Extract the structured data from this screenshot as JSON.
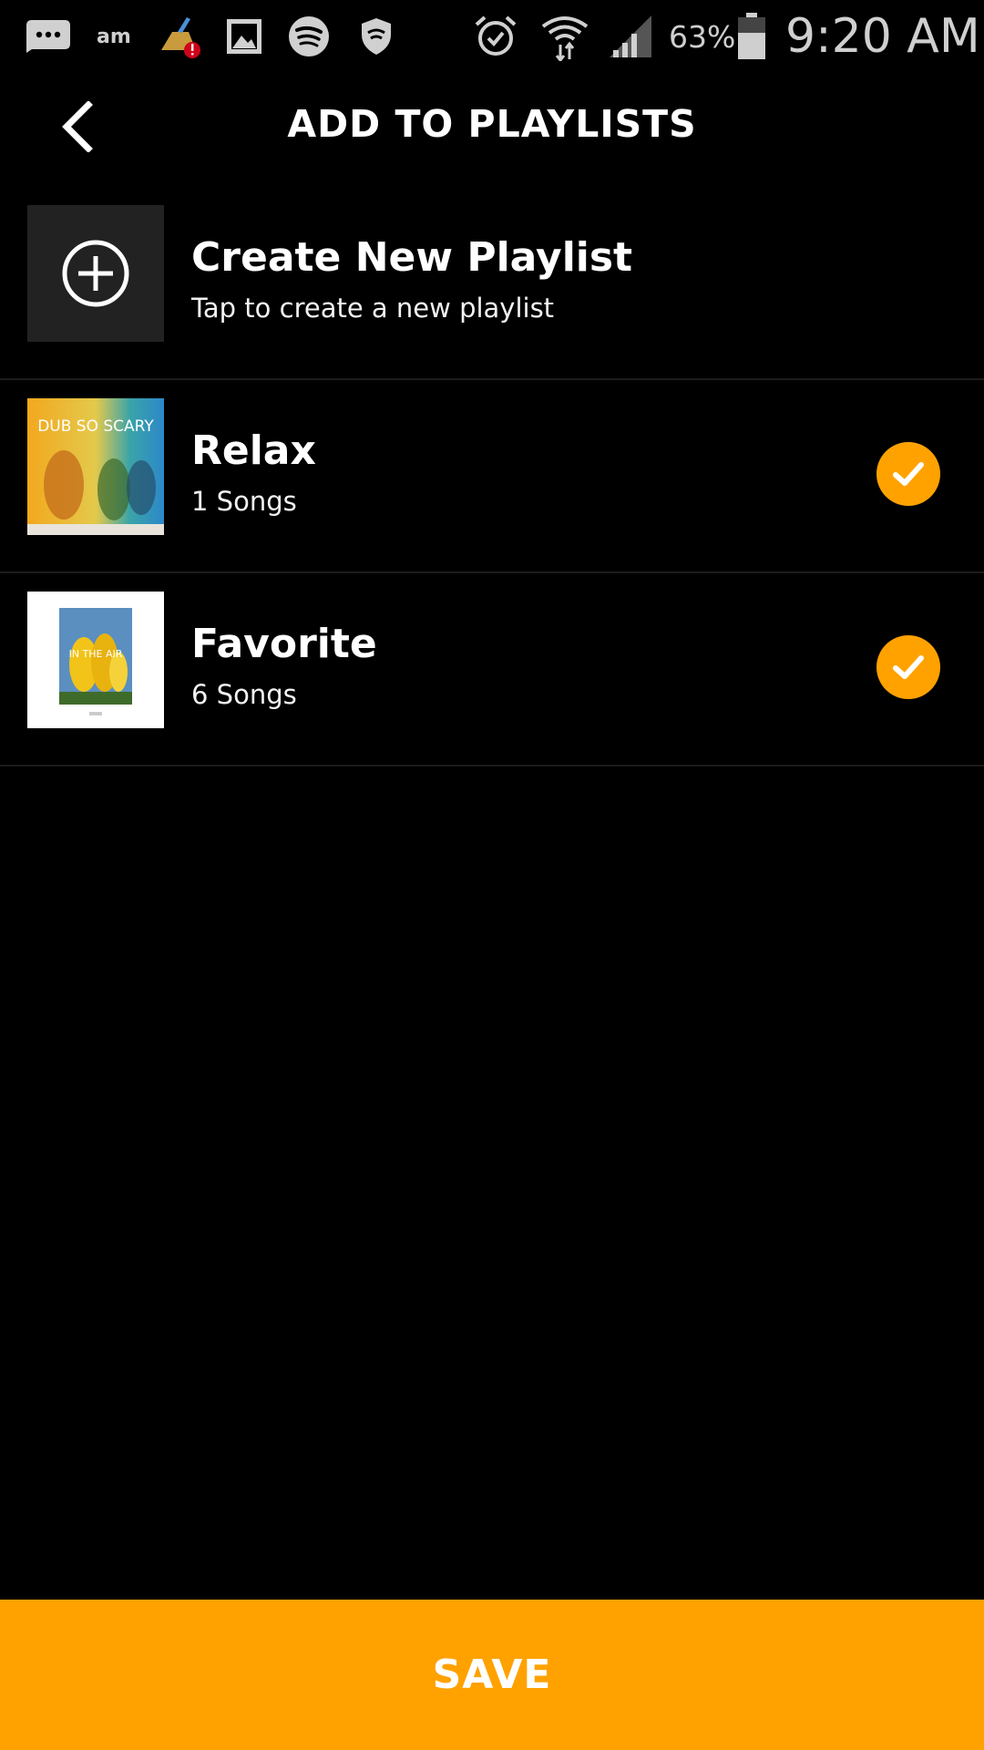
{
  "colors": {
    "background": "#000000",
    "accent": "#FFA200",
    "text": "#FFFFFF",
    "divider": "#1C1C1C",
    "create_tile": "#222222"
  },
  "status_bar": {
    "notification_icons": [
      "messages-icon",
      "am-icon",
      "cleaner-alert-icon",
      "gallery-icon",
      "spotify-icon",
      "shield-icon"
    ],
    "am_label": "am",
    "system_icons": [
      "alarm-icon",
      "wifi-icon",
      "signal-icon"
    ],
    "battery_percent": "63%",
    "battery_level": 0.63,
    "time": "9:20 AM"
  },
  "header": {
    "back_icon": "chevron-left-icon",
    "title": "ADD TO PLAYLISTS"
  },
  "create_playlist": {
    "icon": "plus-circle-icon",
    "title": "Create New Playlist",
    "subtitle": "Tap to create a new playlist"
  },
  "playlists": [
    {
      "name": "Relax",
      "count": "1 Songs",
      "selected": true,
      "artwork_text": "DUB SO SCARY"
    },
    {
      "name": "Favorite",
      "count": "6 Songs",
      "selected": true,
      "artwork_text": "IN THE AIR"
    }
  ],
  "save_button": {
    "label": "SAVE"
  }
}
